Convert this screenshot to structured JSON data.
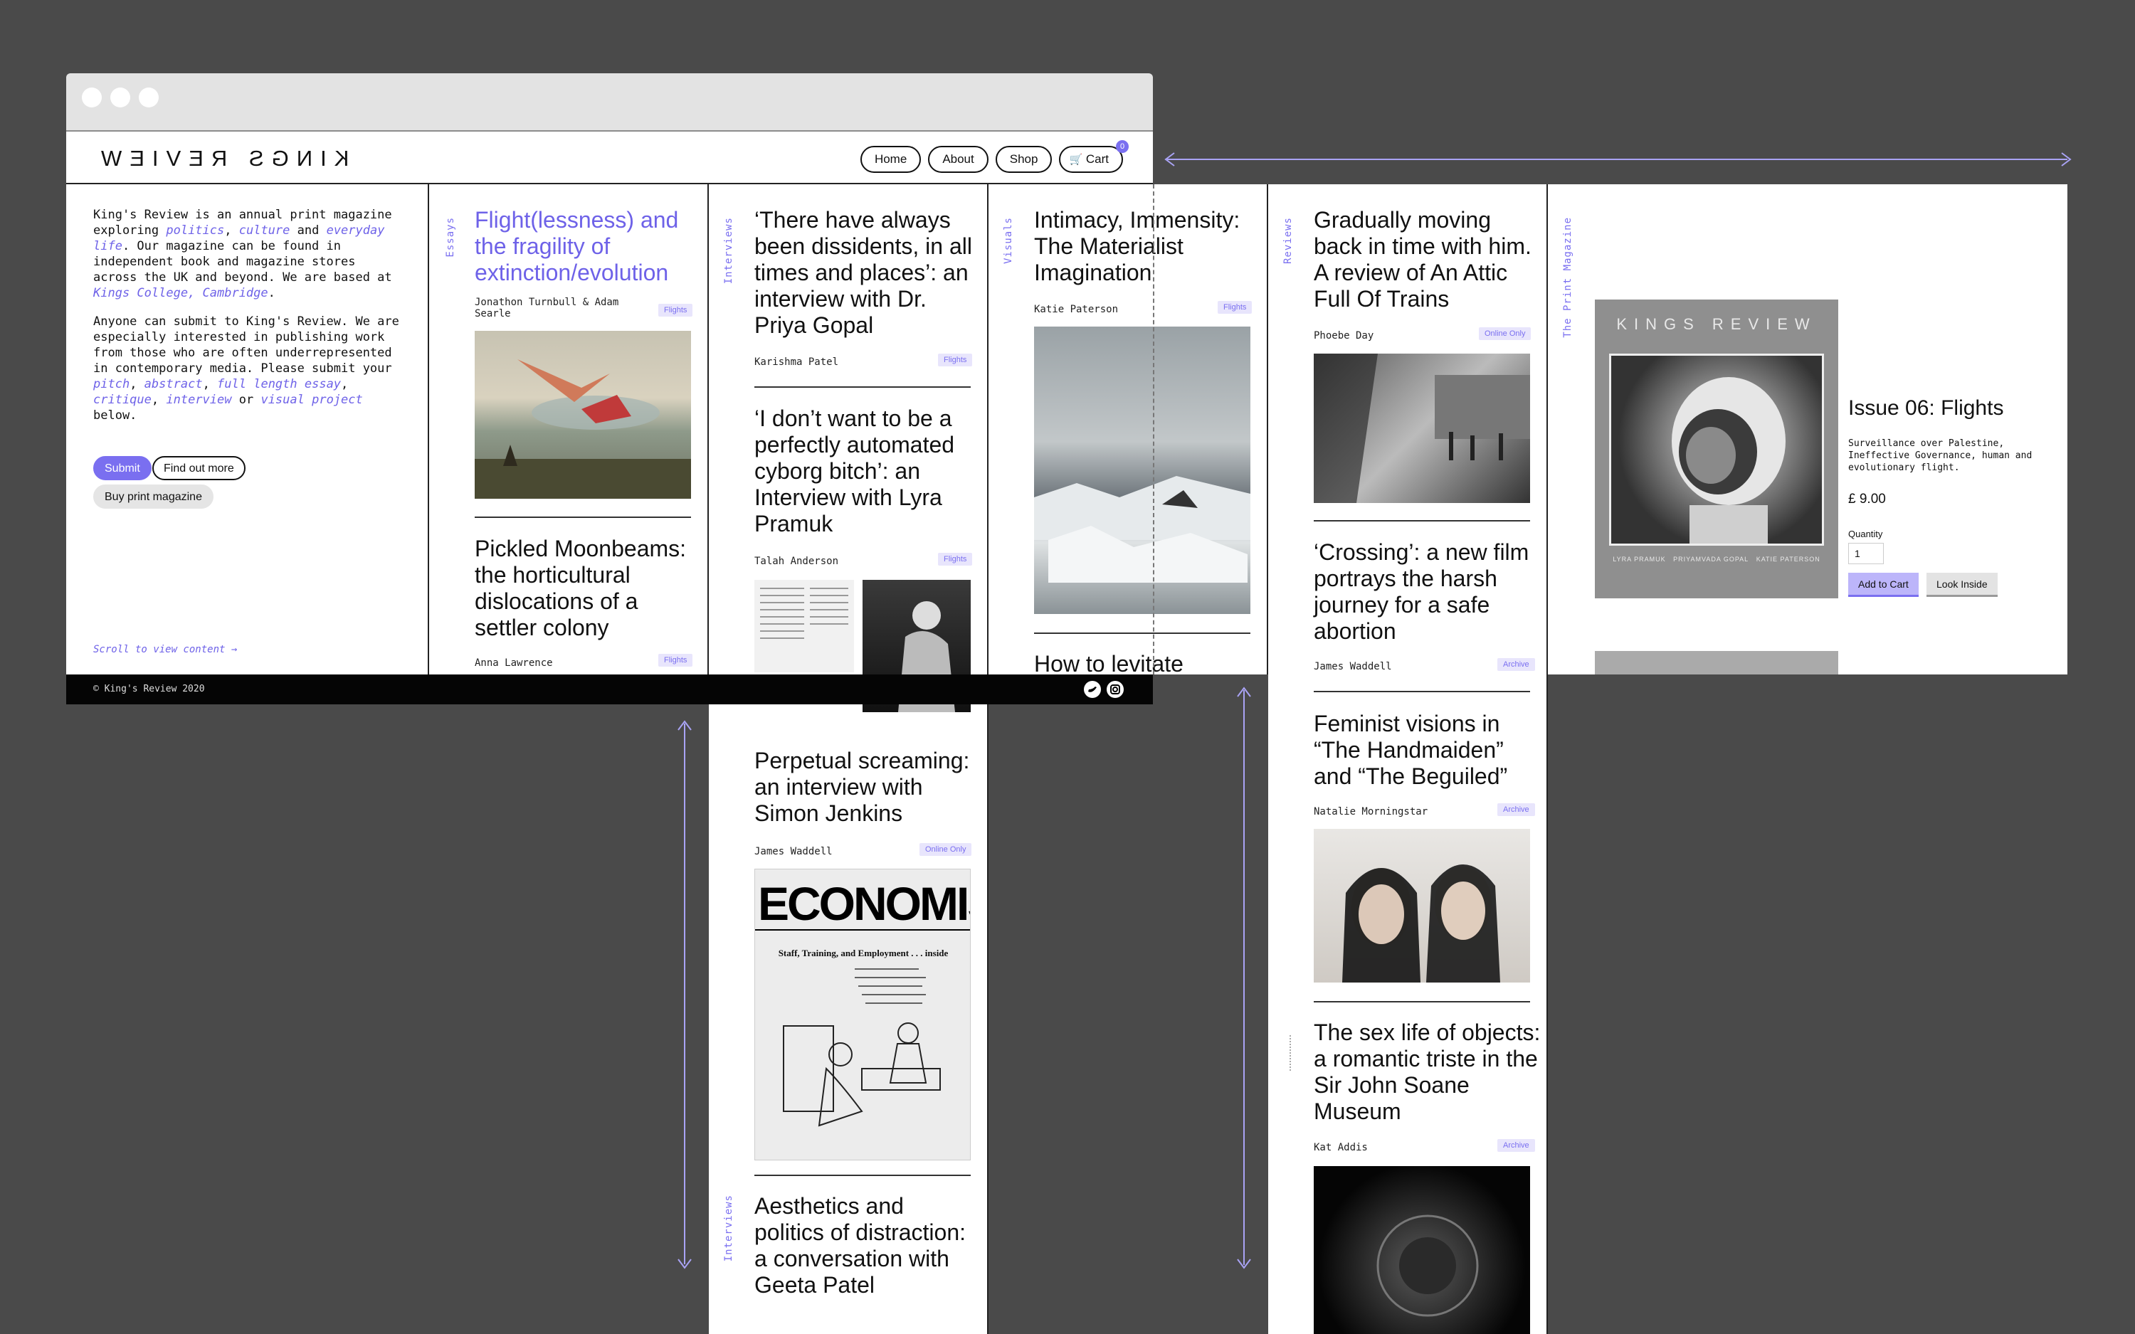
{
  "site": {
    "logo": "KINGS REVIEW",
    "nav": [
      "Home",
      "About",
      "Shop",
      "Cart"
    ],
    "cart_count": "0"
  },
  "intro": {
    "p1_a": "King's Review is an annual print magazine exploring ",
    "p1_politics": "politics",
    "p1_b": ", ",
    "p1_culture": "culture",
    "p1_c": " and ",
    "p1_everyday": "everyday life",
    "p1_d": ". Our magazine can be found in independent book and magazine stores across the UK and beyond. We are based at ",
    "p1_kings": "Kings College, Cambridge",
    "p1_e": ".",
    "p2_a": "Anyone can submit to King's Review. We are especially interested in publishing work from those who are often underrepresented in contemporary media. Please submit your ",
    "p2_pitch": "pitch",
    "p2_abstract": "abstract",
    "p2_essay": "full length essay",
    "p2_critique": "critique",
    "p2_interview": "interview",
    "p2_or": " or ",
    "p2_visual": "visual project",
    "p2_end": " below.",
    "submit": "Submit",
    "find_out": "Find out more",
    "buy": "Buy print magazine",
    "scroll": "Scroll to view content →"
  },
  "columns": {
    "essays": {
      "label": "Essays",
      "articles": [
        {
          "title": "Flight(lessness) and the fragility of extinction/evolution",
          "author": "Jonathon Turnbull & Adam Searle",
          "tag": "Flights"
        },
        {
          "title": "Pickled Moonbeams: the horticultural dislocations of a settler colony",
          "author": "Anna Lawrence",
          "tag": "Flights"
        }
      ]
    },
    "interviews": {
      "label": "Interviews",
      "articles": [
        {
          "title": "‘There have always been dissidents, in all times and places’: an interview with Dr. Priya Gopal",
          "author": "Karishma Patel",
          "tag": "Flights"
        },
        {
          "title": "‘I don’t want to be a perfectly automated cyborg bitch’: an Interview with Lyra Pramuk",
          "author": "Talah Anderson",
          "tag": "Flights"
        },
        {
          "title": "Perpetual screaming: an interview with Simon Jenkins",
          "author": "James Waddell",
          "tag": "Online Only"
        },
        {
          "title": "Aesthetics and politics of distraction: a conversation with Geeta Patel",
          "author": "",
          "tag": ""
        }
      ],
      "economist": "ECONOMIST",
      "economist_sub": "Staff, Training, and Employment . . . inside"
    },
    "visuals": {
      "label": "Visuals",
      "articles": [
        {
          "title": "Intimacy, Immensity: The Materialist Imagination",
          "author": "Katie Paterson",
          "tag": "Flights"
        },
        {
          "title": "How to levitate",
          "author": "",
          "tag": ""
        }
      ]
    },
    "reviews": {
      "label": "Reviews",
      "articles": [
        {
          "title": "Gradually moving back in time with him. A review of An Attic Full Of Trains",
          "author": "Phoebe Day",
          "tag": "Online Only"
        },
        {
          "title": "‘Crossing’: a new film portrays the harsh journey for a safe abortion",
          "author": "James Waddell",
          "tag": "Archive"
        },
        {
          "title": "Feminist visions in “The Handmaiden” and “The Beguiled”",
          "author": "Natalie Morningstar",
          "tag": "Archive"
        },
        {
          "title": "The sex life of objects: a romantic triste in the Sir John Soane Museum",
          "author": "Kat Addis",
          "tag": "Archive"
        }
      ]
    },
    "print": {
      "label": "The Print Magazine",
      "cover_logo": "KINGS REVIEW",
      "cover_names": [
        "LYRA PRAMUK",
        "PRIYAMVADA GOPAL",
        "KATIE PATERSON"
      ],
      "issue": "Issue 06: Flights",
      "desc": "Surveillance over Palestine, Ineffective Governance, human and evolutionary flight.",
      "price": "£ 9.00",
      "qty_label": "Quantity",
      "qty_value": "1",
      "add": "Add to Cart",
      "look": "Look Inside"
    }
  },
  "footer": {
    "copyright": "© King's Review 2020"
  },
  "colors": {
    "accent": "#7a6ff0",
    "tag_bg": "#e8e5fc",
    "background": "#4a4a4a"
  },
  "icons": [
    "twitter-icon",
    "instagram-icon",
    "cart-icon"
  ]
}
